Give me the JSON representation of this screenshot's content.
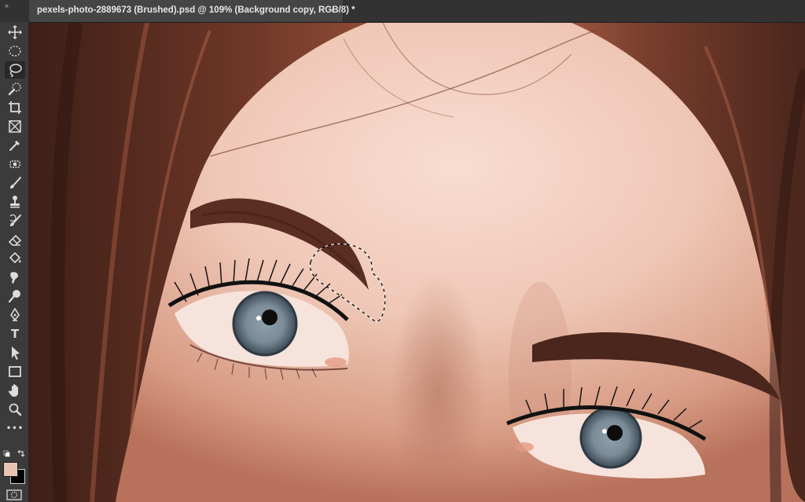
{
  "app": {
    "document_tab": {
      "title": "pexels-photo-2889673 (Brushed).psd @ 109% (Background copy, RGB/8) *",
      "close_glyph": "×"
    },
    "tab_collapse_glyph": "»"
  },
  "toolbar": {
    "active_tool": "lasso",
    "tools": [
      {
        "name": "move-tool",
        "icon": "move-icon"
      },
      {
        "name": "marquee-tool",
        "icon": "elliptical-marquee-icon"
      },
      {
        "name": "lasso-tool",
        "icon": "lasso-icon",
        "active": true
      },
      {
        "name": "quick-selection-tool",
        "icon": "quick-selection-icon"
      },
      {
        "name": "crop-tool",
        "icon": "crop-icon"
      },
      {
        "name": "frame-tool",
        "icon": "frame-icon"
      },
      {
        "name": "eyedropper-tool",
        "icon": "eyedropper-icon"
      },
      {
        "name": "healing-brush-tool",
        "icon": "spot-healing-icon"
      },
      {
        "name": "brush-tool",
        "icon": "brush-icon"
      },
      {
        "name": "clone-stamp-tool",
        "icon": "stamp-icon"
      },
      {
        "name": "history-brush-tool",
        "icon": "history-brush-icon"
      },
      {
        "name": "eraser-tool",
        "icon": "eraser-icon"
      },
      {
        "name": "paint-bucket-tool",
        "icon": "paint-bucket-icon"
      },
      {
        "name": "smudge-tool",
        "icon": "smudge-icon"
      },
      {
        "name": "dodge-tool",
        "icon": "dodge-icon"
      },
      {
        "name": "pen-tool",
        "icon": "pen-icon"
      },
      {
        "name": "type-tool",
        "icon": "type-icon",
        "label": "T"
      },
      {
        "name": "path-selection-tool",
        "icon": "arrow-icon"
      },
      {
        "name": "rectangle-tool",
        "icon": "rectangle-icon"
      },
      {
        "name": "hand-tool",
        "icon": "hand-icon"
      },
      {
        "name": "zoom-tool",
        "icon": "zoom-icon"
      },
      {
        "name": "edit-toolbar-button",
        "icon": "more-icon",
        "label": "•••"
      }
    ],
    "foreground_color": "#e8c3b4",
    "background_color": "#000000"
  },
  "canvas": {
    "selection": "lasso"
  }
}
